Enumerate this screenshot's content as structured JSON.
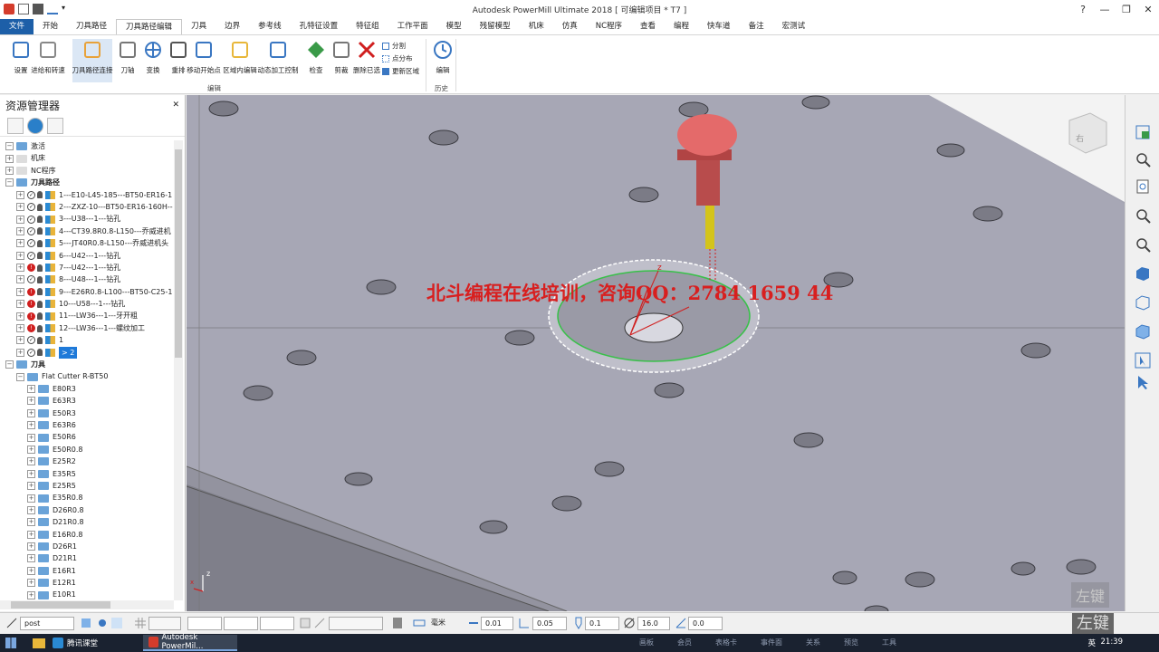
{
  "window": {
    "title": "Autodesk PowerMill Ultimate 2018  [ 可编辑项目 * T7 ]",
    "help": "?",
    "minimize": "—",
    "maximize": "❐",
    "close": "✕"
  },
  "tabs": [
    "文件",
    "开始",
    "刀具路径",
    "刀具路径编辑",
    "刀具",
    "边界",
    "参考线",
    "孔特征设置",
    "特征组",
    "工作平面",
    "模型",
    "残留模型",
    "机床",
    "仿真",
    "NC程序",
    "查看",
    "编程",
    "快车道",
    "备注",
    "宏测试"
  ],
  "ribbon": {
    "buttons": [
      {
        "label": "设置",
        "icon": "settings-icon"
      },
      {
        "label": "进给和转速",
        "icon": "feed-speed-icon"
      },
      {
        "label": "刀具路径连接",
        "icon": "toolpath-connect-icon"
      },
      {
        "label": "刀轴",
        "icon": "tool-axis-icon"
      },
      {
        "label": "变换",
        "icon": "transform-icon"
      },
      {
        "label": "重排",
        "icon": "reorder-icon"
      },
      {
        "label": "移动开始点",
        "icon": "move-start-icon"
      },
      {
        "label": "区域内编辑",
        "icon": "region-edit-icon"
      },
      {
        "label": "动态加工控制",
        "icon": "dynamic-control-icon"
      },
      {
        "label": "检查",
        "icon": "check-icon"
      },
      {
        "label": "剪裁",
        "icon": "trim-icon"
      },
      {
        "label": "删除已选",
        "icon": "delete-icon"
      }
    ],
    "small_buttons": [
      "分割",
      "点分布",
      "更新区域"
    ],
    "history_button": "编辑",
    "group_edit": "编辑",
    "group_history": "历史"
  },
  "explorer": {
    "title": "资源管理器",
    "close": "✕",
    "tree": [
      {
        "label": "激活",
        "level": 0,
        "type": "top"
      },
      {
        "label": "机床",
        "level": 0,
        "type": "leaf"
      },
      {
        "label": "NC程序",
        "level": 0,
        "type": "leaf"
      },
      {
        "label": "刀具路径",
        "level": 0,
        "type": "section"
      },
      {
        "label": "1---E10-L45-185---BT50-ER16-1",
        "level": 1,
        "type": "tp",
        "status": "ok"
      },
      {
        "label": "2---ZXZ-10---BT50-ER16-160H--",
        "level": 1,
        "type": "tp",
        "status": "ok"
      },
      {
        "label": "3---U38---1---钻孔",
        "level": 1,
        "type": "tp",
        "status": "ok"
      },
      {
        "label": "4---CT39.8R0.8-L150---乔威进机",
        "level": 1,
        "type": "tp",
        "status": "ok"
      },
      {
        "label": "5---JT40R0.8-L150---乔威进机头",
        "level": 1,
        "type": "tp",
        "status": "ok"
      },
      {
        "label": "6---U42---1---钻孔",
        "level": 1,
        "type": "tp",
        "status": "ok"
      },
      {
        "label": "7---U42---1---钻孔",
        "level": 1,
        "type": "tp",
        "status": "err"
      },
      {
        "label": "8---U48---1---钻孔",
        "level": 1,
        "type": "tp",
        "status": "ok"
      },
      {
        "label": "9---E26R0.8-L100---BT50-C25-1",
        "level": 1,
        "type": "tp",
        "status": "err"
      },
      {
        "label": "10---U58---1---钻孔",
        "level": 1,
        "type": "tp",
        "status": "err"
      },
      {
        "label": "11---LW36---1---牙开粗",
        "level": 1,
        "type": "tp",
        "status": "err"
      },
      {
        "label": "12---LW36---1---螺纹加工",
        "level": 1,
        "type": "tp",
        "status": "err"
      },
      {
        "label": "1",
        "level": 1,
        "type": "tp",
        "status": "ok"
      },
      {
        "label": "> 2",
        "level": 1,
        "type": "tp",
        "status": "ok",
        "selected": true
      },
      {
        "label": "刀具",
        "level": 0,
        "type": "section"
      },
      {
        "label": "Flat Cutter R-BT50",
        "level": 1,
        "type": "folder"
      },
      {
        "label": "E80R3",
        "level": 2,
        "type": "folder"
      },
      {
        "label": "E63R3",
        "level": 2,
        "type": "folder"
      },
      {
        "label": "E50R3",
        "level": 2,
        "type": "folder"
      },
      {
        "label": "E63R6",
        "level": 2,
        "type": "folder"
      },
      {
        "label": "E50R6",
        "level": 2,
        "type": "folder"
      },
      {
        "label": "E50R0.8",
        "level": 2,
        "type": "folder"
      },
      {
        "label": "E25R2",
        "level": 2,
        "type": "folder"
      },
      {
        "label": "E35R5",
        "level": 2,
        "type": "folder"
      },
      {
        "label": "E25R5",
        "level": 2,
        "type": "folder"
      },
      {
        "label": "E35R0.8",
        "level": 2,
        "type": "folder"
      },
      {
        "label": "D26R0.8",
        "level": 2,
        "type": "folder"
      },
      {
        "label": "D21R0.8",
        "level": 2,
        "type": "folder"
      },
      {
        "label": "E16R0.8",
        "level": 2,
        "type": "folder"
      },
      {
        "label": "D26R1",
        "level": 2,
        "type": "folder"
      },
      {
        "label": "D21R1",
        "level": 2,
        "type": "folder"
      },
      {
        "label": "E16R1",
        "level": 2,
        "type": "folder"
      },
      {
        "label": "E12R1",
        "level": 2,
        "type": "folder"
      },
      {
        "label": "E10R1",
        "level": 2,
        "type": "folder"
      }
    ]
  },
  "viewport": {
    "watermark": "北斗编程在线培训，咨询QQ：2784 1659 44",
    "cube_label": "右",
    "axis_z": "z",
    "axis_x": "x",
    "overlay_key": "左键"
  },
  "statusbar": {
    "workplane": "post",
    "unit": "毫米",
    "tolerance": "0.01",
    "stock": "0.05",
    "field3": "0.1",
    "diameter": "16.0",
    "angle": "0.0",
    "overlay_key": "左键"
  },
  "taskbar": {
    "apps": [
      "腾讯课堂",
      "Autodesk PowerMil..."
    ],
    "tray_items": [
      "画板",
      "会员",
      "表格卡",
      "事件面",
      "关系",
      "预览",
      "工具"
    ],
    "ime": "英",
    "time": "21:39"
  },
  "colors": {
    "accent": "#1d5fa8",
    "viewport_bg": "#a4a4b2",
    "tool_holder": "#e46a6a",
    "tool_tip": "#d4c41a",
    "watermark": "#d81f1f",
    "error": "#d01f1f"
  }
}
